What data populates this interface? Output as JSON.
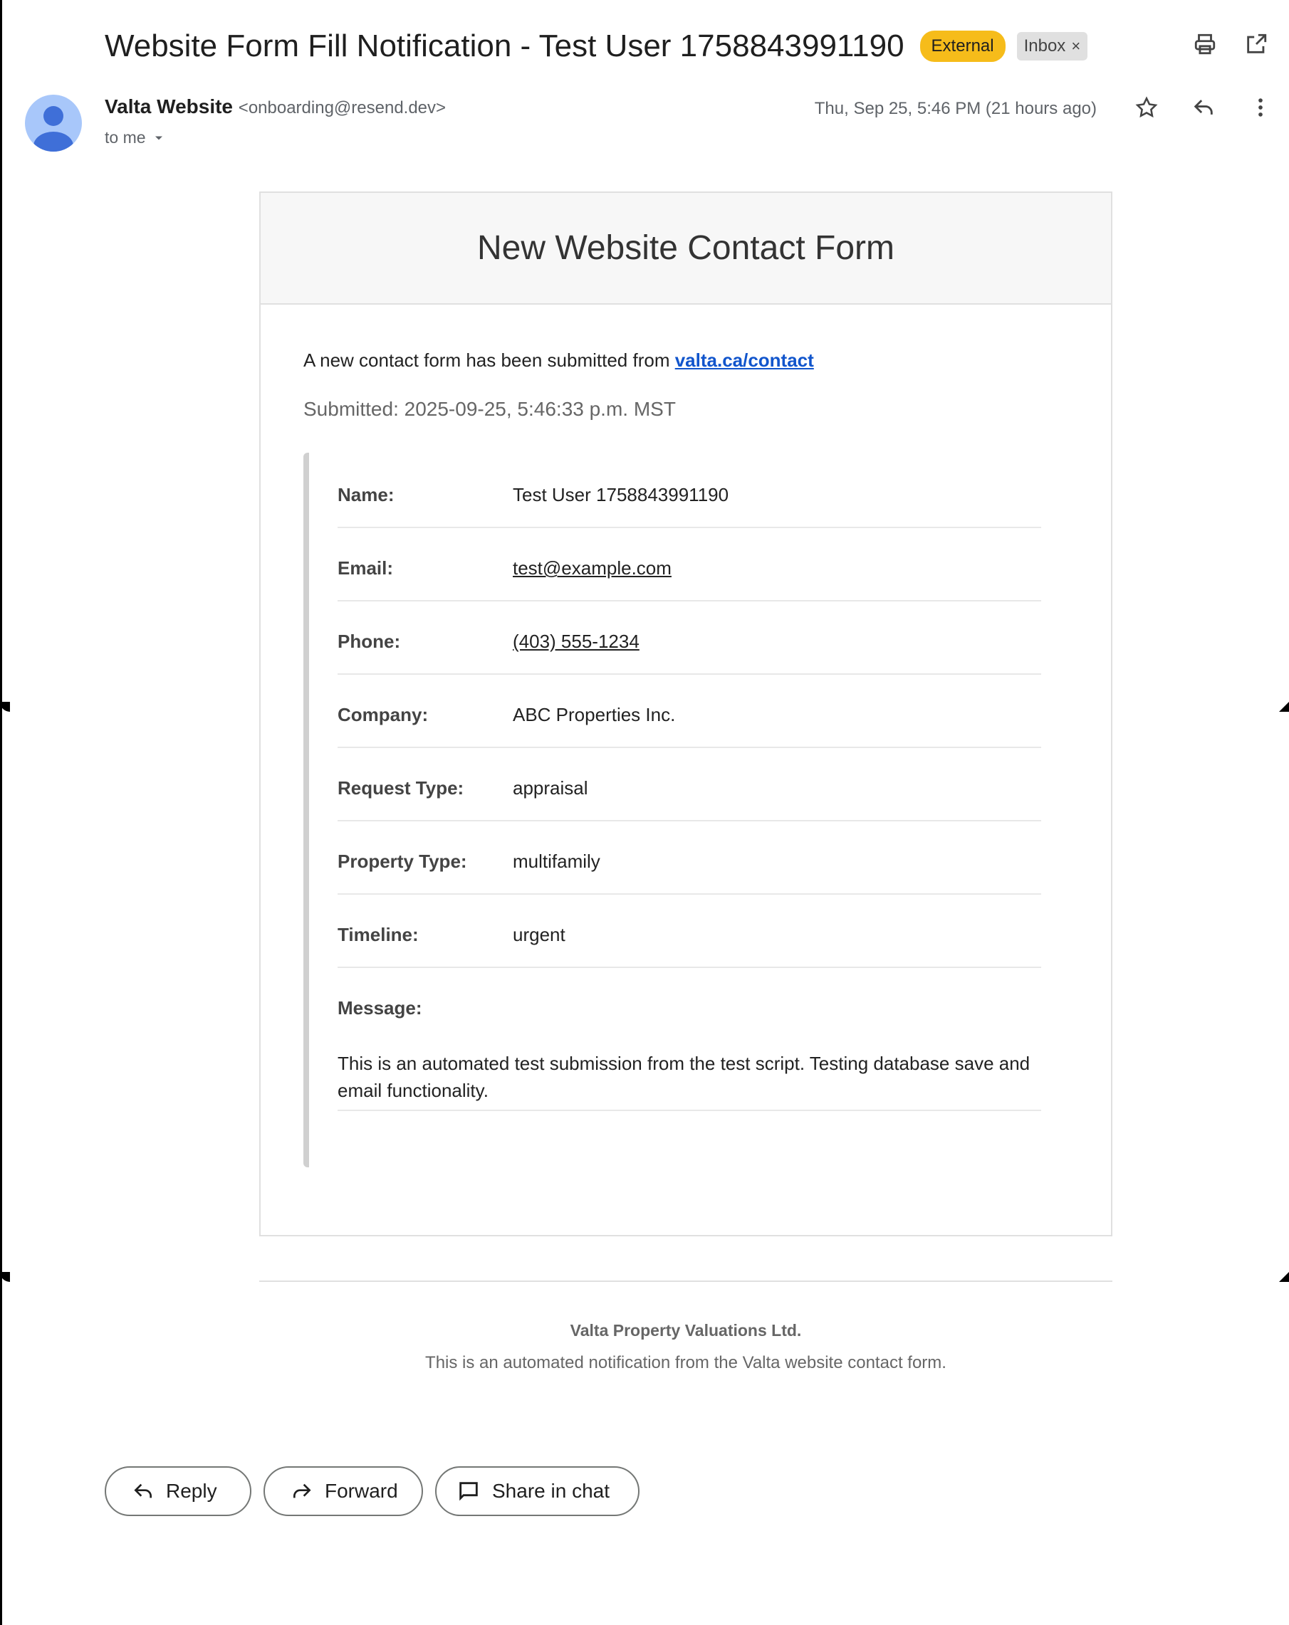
{
  "subject": "Website Form Fill Notification - Test User 1758843991190",
  "labels": {
    "external": "External",
    "inbox": "Inbox",
    "remove": "×"
  },
  "sender": {
    "name": "Valta Website",
    "email": "<onboarding@resend.dev>",
    "to": "to me"
  },
  "date": "Thu, Sep 25, 5:46 PM (21 hours ago)",
  "icons": [
    "print-icon",
    "open-in-new-window-icon",
    "star-icon",
    "reply-icon",
    "more-vert-icon",
    "chevron-down-icon",
    "forward-icon",
    "chat-icon"
  ],
  "email": {
    "title": "New Website Contact Form",
    "intro": "A new contact form has been submitted from ",
    "intro_link": "valta.ca/contact",
    "submitted": "Submitted: 2025-09-25, 5:46:33 p.m. MST",
    "fields": {
      "name": {
        "label": "Name:",
        "value": "Test User 1758843991190"
      },
      "email": {
        "label": "Email:",
        "value": "test@example.com"
      },
      "phone": {
        "label": "Phone:",
        "value": "(403) 555-1234"
      },
      "company": {
        "label": "Company:",
        "value": "ABC Properties Inc."
      },
      "request_type": {
        "label": "Request Type:",
        "value": "appraisal"
      },
      "property_type": {
        "label": "Property Type:",
        "value": "multifamily"
      },
      "timeline": {
        "label": "Timeline:",
        "value": "urgent"
      },
      "message": {
        "label": "Message:",
        "value": "This is an automated test submission from the test script. Testing database save and email functionality."
      }
    },
    "footer_company": "Valta Property Valuations Ltd.",
    "footer_note": "This is an automated notification from the Valta website contact form."
  },
  "actions": {
    "reply": "Reply",
    "forward": "Forward",
    "share": "Share in chat"
  },
  "colors": {
    "external_badge": "#f6bc1a",
    "link": "#1155cc",
    "avatar": "#a8c7fa",
    "avatar_figure": "#3f6fd8"
  }
}
